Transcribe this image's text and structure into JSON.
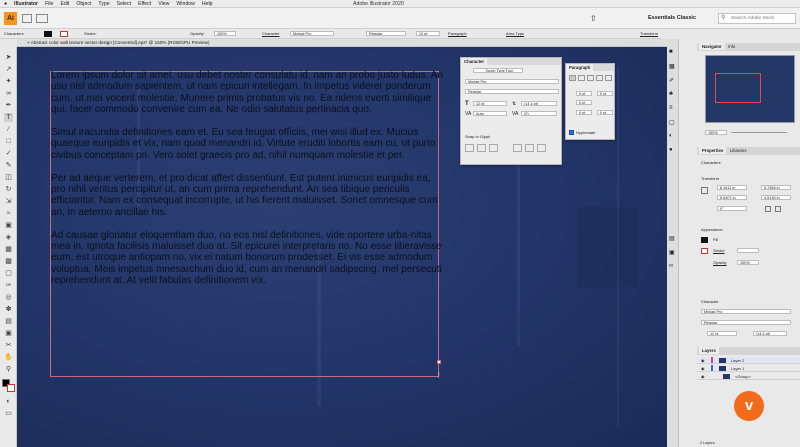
{
  "menubar": {
    "apple": "",
    "app": "Illustrator",
    "items": [
      "File",
      "Edit",
      "Object",
      "Type",
      "Select",
      "Effect",
      "View",
      "Window",
      "Help"
    ],
    "title": "Adobe Illustrator 2020"
  },
  "toolbar": {
    "workspace": "Essentials Classic",
    "search_placeholder": "Search Adobe Stock"
  },
  "control": {
    "label": "Characters",
    "stroke": "Stroke:",
    "opacity": "Opacity:",
    "opacity_val": "100%",
    "character": "Character",
    "font": "Myriad Pro",
    "style": "Regular",
    "size": "12 pt",
    "paragraph": "Paragraph",
    "area_type": "Area Type",
    "transform": "Transform"
  },
  "doc_tab": "Abstract color wall texture vector design [Converted].eps* @ 150% (RGB/GPU Preview)",
  "text": [
    "Lorem ipsum dolor sit amet, usu debet noster consulatu id, nam an probo justo ludus. An usu nisl admodum sapientem, ut nam epicuri intellegam. In impetus viderer ponderum cum, ut mei vocent molestie. Munere primis probatus vis no. Ea ridens everti similique qui, facer commodo convenire cum ea. Ne odio salutatus pertinacia quo.",
    "Simul iracundia definitiones eam et. Eu sea feugiat officiis, mei wisi illud ex. Mucius quaeque euripidis et vix, nam quod menandri id. Virtute eruditi lobortis eam cu, ut purto civibus conceptam pri. Vero solet graecis pro ad, nihil numquam molestie et per.",
    "Per ad aeque verterem, et pro dicat affert dissentiunt. Est putent inimicus euripidis ea, pro nihil veritus percipitur ut, an cum prima reprehendunt. An sea tibique periculis efficiantur. Nam ex consequat incorrupte, ut his fierent maluisset. Sonet omnesque cum an, in aeterno ancillae his.",
    "Ad causae gloriatur eloquentiam duo, no eos nisl definitiones, vide oportere urba-nitas mea in. Ignota facilisis maluisset duo at. Sit epicurei interpretaris no. No esse liberavisse eum, est utroque antiopam no, vix ei natum bonorum prodesset. Ei vis esse admodum voluptua. Meis impetus mnesarchum duo id, cum an menandri sadipscing, mel persecuti reprehendunt at. At velit fabulas definitionem vix."
  ],
  "character_panel": {
    "tab": "Character",
    "touch": "Touch Type Tool",
    "font": "Myriad Pro",
    "style": "Regular",
    "size": "12 pt",
    "leading": "(14.4 pt)",
    "kern": "Auto",
    "track": "(0)",
    "snap": "Snap to Glyph"
  },
  "paragraph_panel": {
    "tab": "Paragraph",
    "indent_left": "0 pt",
    "indent_right": "0 pt",
    "first": "0 pt",
    "space_before": "0 pt",
    "space_after": "0 pt",
    "hyphenate": "Hyphenate"
  },
  "navigator": {
    "tab1": "Navigator",
    "tab2": "Info",
    "zoom": "150%"
  },
  "properties": {
    "tab1": "Properties",
    "tab2": "Libraries",
    "section": "Characters",
    "transform": "Transform",
    "x": "8.1611 in",
    "y": "5.6407 in",
    "w": "5.7456 in",
    "h": "4.5139 in",
    "angle": "0°",
    "appearance": "Appearance",
    "fill": "Fill",
    "stroke": "Stroke",
    "opacity": "Opacity",
    "opacity_val": "100%",
    "character": "Character",
    "font": "Myriad Pro",
    "style": "Regular",
    "size": "12 pt",
    "leading": "(14.4 pt)"
  },
  "layers": {
    "tab": "Layers",
    "items": [
      "Layer 2",
      "Layer 1",
      "<Group>"
    ],
    "count": "2 Layers"
  },
  "colors": {
    "canvas": "#23366a",
    "frame": "#c86a78",
    "brand": "#f26b1d"
  }
}
